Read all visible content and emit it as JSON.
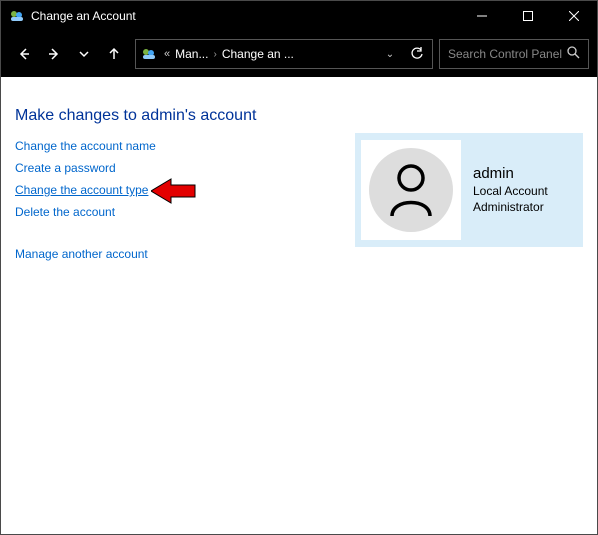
{
  "window": {
    "title": "Change an Account"
  },
  "nav": {
    "address_seg1": "Man...",
    "address_seg2": "Change an ...",
    "search_placeholder": "Search Control Panel"
  },
  "page": {
    "heading": "Make changes to admin's account",
    "links": {
      "change_name": "Change the account name",
      "create_password": "Create a password",
      "change_type": "Change the account type",
      "delete_account": "Delete the account",
      "manage_another": "Manage another account"
    }
  },
  "account": {
    "name": "admin",
    "type": "Local Account",
    "role": "Administrator"
  }
}
